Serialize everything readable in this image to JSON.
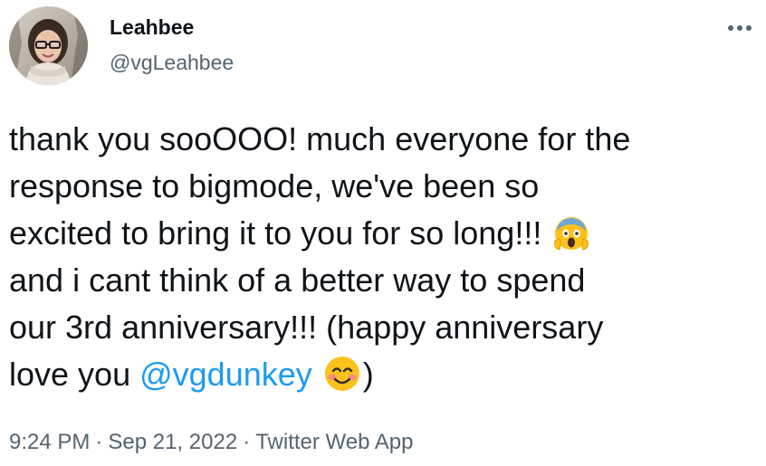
{
  "author": {
    "display_name": "Leahbee",
    "handle": "@vgLeahbee"
  },
  "tweet": {
    "lines": [
      "thank you sooOOO! much everyone for the",
      "response to bigmode, we've been so",
      "excited to bring it to you for so long!!!",
      "and i cant think of a better way to spend",
      "our 3rd anniversary!!! (happy anniversary",
      "love you"
    ],
    "mention": "@vgdunkey",
    "closing": ")",
    "emojis": [
      "face-screaming-in-fear-emoji",
      "smiling-face-with-smiling-eyes-emoji"
    ]
  },
  "meta": {
    "time": "9:24 PM",
    "separator": "·",
    "date": "Sep 21, 2022",
    "source": "Twitter Web App"
  },
  "icons": {
    "more": "more-horizontal-icon"
  },
  "colors": {
    "text": "#0f1419",
    "secondary": "#536471",
    "link": "#1d9bf0"
  }
}
